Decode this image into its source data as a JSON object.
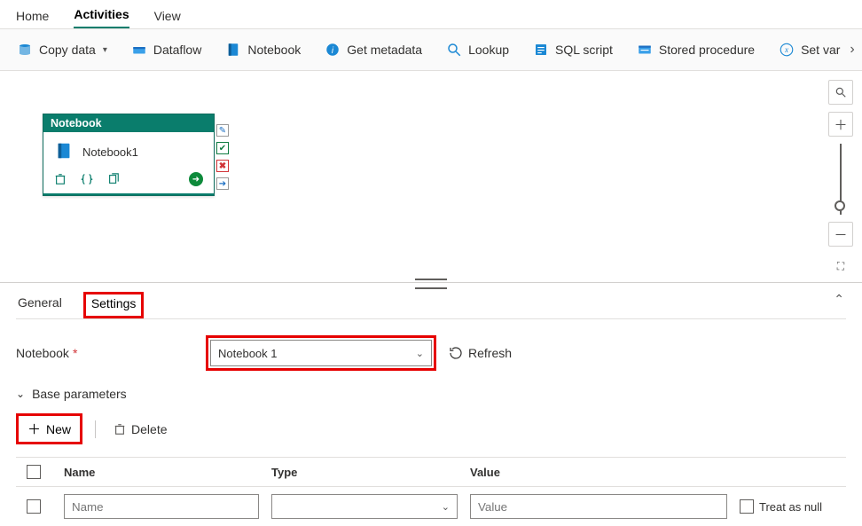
{
  "top_tabs": {
    "home": "Home",
    "activities": "Activities",
    "view": "View"
  },
  "toolbar": {
    "copy_data": "Copy data",
    "dataflow": "Dataflow",
    "notebook": "Notebook",
    "get_metadata": "Get metadata",
    "lookup": "Lookup",
    "sql_script": "SQL script",
    "stored_procedure": "Stored procedure",
    "set_var": "Set var"
  },
  "canvas": {
    "node_type": "Notebook",
    "node_name": "Notebook1"
  },
  "bottom": {
    "tab_general": "General",
    "tab_settings": "Settings",
    "notebook_label": "Notebook",
    "notebook_value": "Notebook 1",
    "refresh": "Refresh",
    "base_params": "Base parameters",
    "new_btn": "New",
    "delete_btn": "Delete",
    "col_name": "Name",
    "col_type": "Type",
    "col_value": "Value",
    "treat_null": "Treat as null",
    "name_placeholder": "Name",
    "value_placeholder": "Value"
  }
}
